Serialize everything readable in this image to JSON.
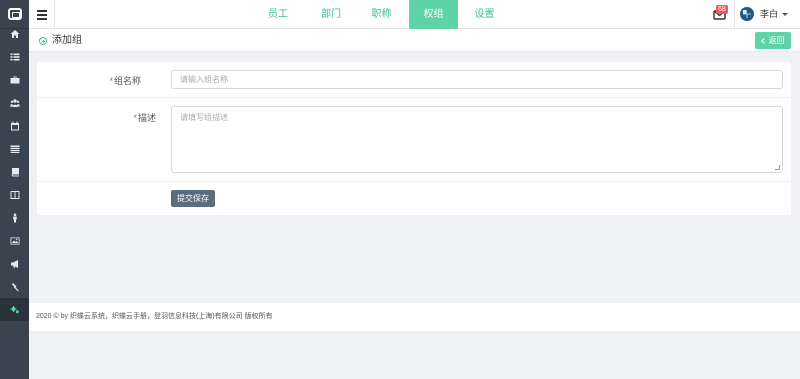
{
  "sidebar": {
    "items": [
      {
        "icon": "home-icon",
        "active": false
      },
      {
        "icon": "list-icon",
        "active": false
      },
      {
        "icon": "briefcase-icon",
        "active": false
      },
      {
        "icon": "users-icon",
        "active": false
      },
      {
        "icon": "calendar-icon",
        "active": false
      },
      {
        "icon": "table-icon",
        "active": false
      },
      {
        "icon": "book-icon",
        "active": false
      },
      {
        "icon": "columns-icon",
        "active": false
      },
      {
        "icon": "person-icon",
        "active": false
      },
      {
        "icon": "image-icon",
        "active": false
      },
      {
        "icon": "megaphone-icon",
        "active": false
      },
      {
        "icon": "gavel-icon",
        "active": false
      },
      {
        "icon": "gears-icon",
        "active": true
      }
    ]
  },
  "header": {
    "tabs": [
      {
        "label": "员工",
        "active": false
      },
      {
        "label": "部门",
        "active": false
      },
      {
        "label": "职称",
        "active": false
      },
      {
        "label": "权组",
        "active": true
      },
      {
        "label": "设置",
        "active": false
      }
    ],
    "mail_badge": "68",
    "user_name": "李白"
  },
  "page": {
    "title": "添加组",
    "back_label": "返回"
  },
  "form": {
    "required_mark": "*",
    "group_name_label": "组名称",
    "group_name_placeholder": "请输入组名称",
    "description_label": "描述",
    "description_placeholder": "请填写组描述",
    "submit_label": "提交保存"
  },
  "footer": {
    "text": "2020 © by 织蝶云系统，织蝶云手册，登羽信息科技(上海)有限公司 版权所有"
  },
  "colors": {
    "accent": "#5ed3a8",
    "sidebar_bg": "#3a4451",
    "submit_bg": "#5c6c7f",
    "badge": "#f35b5b"
  }
}
